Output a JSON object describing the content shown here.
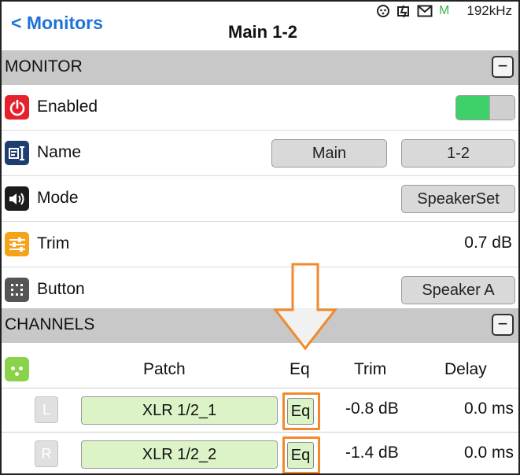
{
  "header": {
    "back_label": "< Monitors",
    "title": "Main 1-2",
    "status": {
      "icons": [
        "power-plug-icon",
        "split-icon",
        "mail-icon"
      ],
      "m_indicator": "M",
      "sample_rate": "192kHz"
    }
  },
  "monitor_section": {
    "label": "MONITOR",
    "collapse_symbol": "−",
    "rows": {
      "enabled": {
        "label": "Enabled",
        "toggle_on": true,
        "icon_color": "#e5212b"
      },
      "name": {
        "label": "Name",
        "value_1": "Main",
        "value_2": "1-2",
        "icon_color": "#1d3e6e"
      },
      "mode": {
        "label": "Mode",
        "value": "SpeakerSet",
        "icon_color": "#1c1c1c"
      },
      "trim": {
        "label": "Trim",
        "value": "0.7 dB",
        "icon_color": "#f6a21a"
      },
      "button": {
        "label": "Button",
        "value": "Speaker A",
        "icon_color": "#555555"
      }
    }
  },
  "channels_section": {
    "label": "CHANNELS",
    "collapse_symbol": "−",
    "headers": {
      "patch": "Patch",
      "eq": "Eq",
      "trim": "Trim",
      "delay": "Delay"
    },
    "rows": [
      {
        "channel": "L",
        "patch": "XLR 1/2_1",
        "eq": "Eq",
        "trim": "-0.8 dB",
        "delay": "0.0 ms"
      },
      {
        "channel": "R",
        "patch": "XLR 1/2_2",
        "eq": "Eq",
        "trim": "-1.4 dB",
        "delay": "0.0 ms"
      }
    ]
  },
  "accent_colors": {
    "link_blue": "#1f73d8",
    "toggle_green": "#3ed16a",
    "patch_green": "#dcf3c8",
    "annotation_orange": "#f08a2c"
  }
}
